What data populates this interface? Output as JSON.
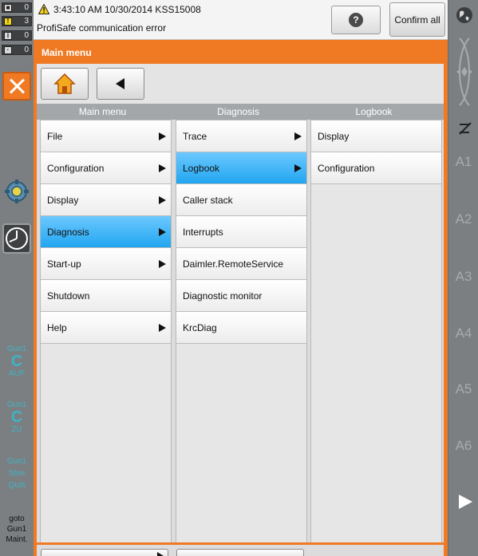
{
  "left_status": {
    "counters": [
      {
        "icon": "stop-message-icon",
        "color": "#d8d8d8",
        "value": "0"
      },
      {
        "icon": "acknowledge-message-icon",
        "color": "#f2d21a",
        "value": "3"
      },
      {
        "icon": "status-message-icon",
        "color": "#d8d8d8",
        "value": "0"
      },
      {
        "icon": "wait-message-icon",
        "color": "#d8d8d8",
        "value": "0"
      }
    ],
    "tech_keys": [
      {
        "top": "Gun1",
        "letter": "C",
        "bottom": "AUF"
      },
      {
        "top": "Gun1",
        "letter": "C",
        "bottom": "ZU"
      },
      {
        "lines": [
          "Gun1",
          "Stoe",
          "Quitt"
        ]
      }
    ],
    "goto": [
      "goto",
      "Gun1",
      "Maint."
    ]
  },
  "message": {
    "line1": "3:43:10 AM 10/30/2014 KSS15008",
    "line2": "ProfiSafe communication error",
    "help_label": "?",
    "confirm_all_label": "Confirm all"
  },
  "right_status": {
    "axes": [
      "A1",
      "A2",
      "A3",
      "A4",
      "A5",
      "A6"
    ]
  },
  "main_menu": {
    "title": "Main menu",
    "columns": [
      {
        "header": "Main menu",
        "items": [
          {
            "label": "File",
            "submenu": true
          },
          {
            "label": "Configuration",
            "submenu": true
          },
          {
            "label": "Display",
            "submenu": true
          },
          {
            "label": "Diagnosis",
            "submenu": true,
            "selected": true
          },
          {
            "label": "Start-up",
            "submenu": true
          },
          {
            "label": "Shutdown",
            "submenu": false
          },
          {
            "label": "Help",
            "submenu": true
          }
        ]
      },
      {
        "header": "Diagnosis",
        "items": [
          {
            "label": "Trace",
            "submenu": true
          },
          {
            "label": "Logbook",
            "submenu": true,
            "selected": true
          },
          {
            "label": "Caller stack",
            "submenu": false
          },
          {
            "label": "Interrupts",
            "submenu": false
          },
          {
            "label": "Daimler.RemoteService",
            "submenu": false
          },
          {
            "label": "Diagnostic monitor",
            "submenu": false
          },
          {
            "label": "KrcDiag",
            "submenu": false
          }
        ]
      },
      {
        "header": "Logbook",
        "items": [
          {
            "label": "Display",
            "submenu": false
          },
          {
            "label": "Configuration",
            "submenu": false
          }
        ]
      }
    ],
    "bottom_buttons": [
      {
        "label": "",
        "submenu": true
      },
      {
        "label": "",
        "submenu": false
      }
    ]
  },
  "colors": {
    "accent_orange": "#f07a24",
    "selection_blue": "#21a6f0",
    "teal_keys": "#3fb3c4",
    "status_grey": "#7c7f82"
  }
}
